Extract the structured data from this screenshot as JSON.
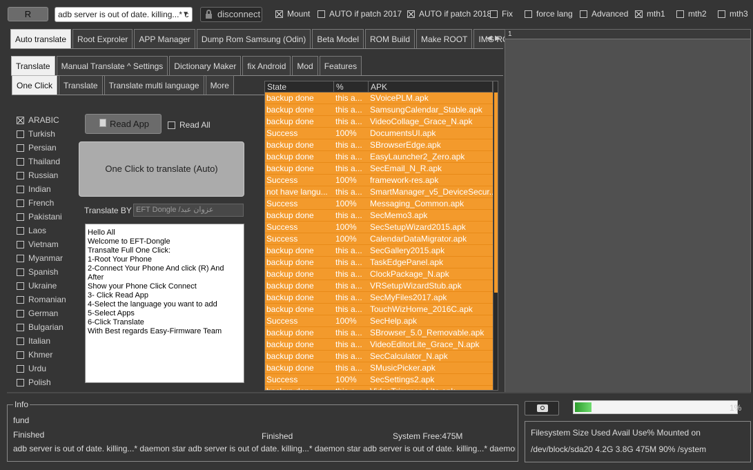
{
  "toolbar": {
    "r_label": "R",
    "combo_value": "adb server is out of date.  killing...* c",
    "disconnect_label": "disconnect",
    "checks": [
      {
        "label": "Mount",
        "checked": true
      },
      {
        "label": "AUTO if patch 2017",
        "checked": false
      },
      {
        "label": "AUTO if patch 2018",
        "checked": true
      },
      {
        "label": "Fix",
        "checked": false
      },
      {
        "label": "force lang",
        "checked": false
      },
      {
        "label": "Advanced",
        "checked": false
      },
      {
        "label": "mth1",
        "checked": true
      },
      {
        "label": "mth2",
        "checked": false
      },
      {
        "label": "mth3",
        "checked": false
      }
    ]
  },
  "main_tabs": [
    "Auto translate",
    "Root Exproler",
    "APP Manager",
    "Dump Rom Samsung (Odin)",
    "Beta Model",
    "ROM Build",
    "Make ROOT",
    "IMG ROM Editor"
  ],
  "sub_tabs": [
    "Translate",
    "Manual Translate ^ Settings",
    "Dictionary Maker",
    "fix Android",
    "Mod",
    "Features"
  ],
  "sub_sub_tabs": [
    "One Click",
    "Translate",
    "Translate multi language",
    "More"
  ],
  "languages": [
    {
      "label": "ARABIC",
      "checked": true
    },
    {
      "label": "Turkish",
      "checked": false
    },
    {
      "label": "Persian",
      "checked": false
    },
    {
      "label": "Thailand",
      "checked": false
    },
    {
      "label": "Russian",
      "checked": false
    },
    {
      "label": "Indian",
      "checked": false
    },
    {
      "label": "French",
      "checked": false
    },
    {
      "label": "Pakistani",
      "checked": false
    },
    {
      "label": "Laos",
      "checked": false
    },
    {
      "label": "Vietnam",
      "checked": false
    },
    {
      "label": "Myanmar",
      "checked": false
    },
    {
      "label": "Spanish",
      "checked": false
    },
    {
      "label": "Ukraine",
      "checked": false
    },
    {
      "label": "Romanian",
      "checked": false
    },
    {
      "label": "German",
      "checked": false
    },
    {
      "label": "Bulgarian",
      "checked": false
    },
    {
      "label": "Italian",
      "checked": false
    },
    {
      "label": "Khmer",
      "checked": false
    },
    {
      "label": "Urdu",
      "checked": false
    },
    {
      "label": "Polish",
      "checked": false
    }
  ],
  "panel": {
    "read_app_label": "Read App",
    "read_all_label": "Read All",
    "one_click_label": "One Click to translate (Auto)",
    "translate_by_label": "Translate BY",
    "translate_by_value": "EFT Dongle /عزوان عبد",
    "memo_lines": [
      "Hello All",
      "Welcome to EFT-Dongle",
      "Transalte Full One Click:",
      "1-Root Your Phone",
      "2-Connect Your Phone And click (R) And After",
      "Show your Phone Click Connect",
      "3- Click Read App",
      "4-Select the language you want to add",
      "5-Select Apps",
      "6-Click Translate",
      "With Best regards Easy-Firmware Team"
    ]
  },
  "table": {
    "columns": [
      "State",
      "%",
      "APK"
    ],
    "row_color": "#f39a2c",
    "rows": [
      [
        "backup done",
        "this a...",
        "SVoicePLM.apk"
      ],
      [
        "backup done",
        "this a...",
        "SamsungCalendar_Stable.apk"
      ],
      [
        "backup done",
        "this a...",
        "VideoCollage_Grace_N.apk"
      ],
      [
        "Success",
        "100%",
        "DocumentsUI.apk"
      ],
      [
        "backup done",
        "this a...",
        "SBrowserEdge.apk"
      ],
      [
        "backup done",
        "this a...",
        "EasyLauncher2_Zero.apk"
      ],
      [
        "backup done",
        "this a...",
        "SecEmail_N_R.apk"
      ],
      [
        "Success",
        "100%",
        "framework-res.apk"
      ],
      [
        "not have langu...",
        "this a...",
        "SmartManager_v5_DeviceSecur..."
      ],
      [
        "Success",
        "100%",
        "Messaging_Common.apk"
      ],
      [
        "backup done",
        "this a...",
        "SecMemo3.apk"
      ],
      [
        "Success",
        "100%",
        "SecSetupWizard2015.apk"
      ],
      [
        "Success",
        "100%",
        "CalendarDataMigrator.apk"
      ],
      [
        "backup done",
        "this a...",
        "SecGallery2015.apk"
      ],
      [
        "backup done",
        "this a...",
        "TaskEdgePanel.apk"
      ],
      [
        "backup done",
        "this a...",
        "ClockPackage_N.apk"
      ],
      [
        "backup done",
        "this a...",
        "VRSetupWizardStub.apk"
      ],
      [
        "backup done",
        "this a...",
        "SecMyFiles2017.apk"
      ],
      [
        "backup done",
        "this a...",
        "TouchWizHome_2016C.apk"
      ],
      [
        "Success",
        "100%",
        "SecHelp.apk"
      ],
      [
        "backup done",
        "this a...",
        "SBrowser_5.0_Removable.apk"
      ],
      [
        "backup done",
        "this a...",
        "VideoEditorLite_Grace_N.apk"
      ],
      [
        "backup done",
        "this a...",
        "SecCalculator_N.apk"
      ],
      [
        "backup done",
        "this a...",
        "SMusicPicker.apk"
      ],
      [
        "Success",
        "100%",
        "SecSettings2.apk"
      ],
      [
        "backup done",
        "this a...",
        "VideoTrimmer_Lite.apk"
      ]
    ]
  },
  "right_panel": {
    "header": "1"
  },
  "info": {
    "legend": "Info",
    "line1": "fund",
    "finished_left": "Finished",
    "finished_mid": "Finished",
    "system_free": "System Free:475M",
    "log_line": "adb server is out of date.  killing...* daemon star  adb server is out of date.  killing...* daemon star  adb server is out of date.  killing...* daemon star"
  },
  "progress": {
    "value": 0.1,
    "text": "1%"
  },
  "filesystem": {
    "header": "Filesystem       Size  Used Avail Use% Mounted on",
    "row": "/dev/block/sda20 4.2G  3.8G  475M  90% /system"
  }
}
